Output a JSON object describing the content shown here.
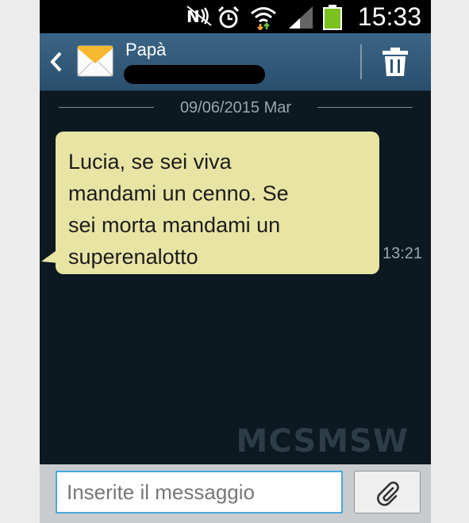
{
  "status_bar": {
    "time": "15:33",
    "icons": [
      "nfc-icon",
      "alarm-icon",
      "wifi-icon",
      "signal-icon",
      "battery-icon"
    ]
  },
  "header": {
    "contact_name": "Papà",
    "icons": [
      "back-arrow-icon",
      "envelope-icon",
      "trash-icon"
    ]
  },
  "conversation": {
    "date_separator": "09/06/2015 Mar",
    "messages": [
      {
        "text": "Lucia, se sei viva\nmandami un cenno. Se\nsei morta mandami un\nsuperenalotto",
        "time": "13:21",
        "direction": "incoming"
      }
    ]
  },
  "watermark": "MCSMSW",
  "composer": {
    "placeholder": "Inserite il messaggio",
    "value": "",
    "attach_icon": "paperclip-icon"
  },
  "colors": {
    "header": "#325a7a",
    "background": "#0c1920",
    "bubble": "#e8e4a4",
    "input_border": "#4aa7df"
  }
}
